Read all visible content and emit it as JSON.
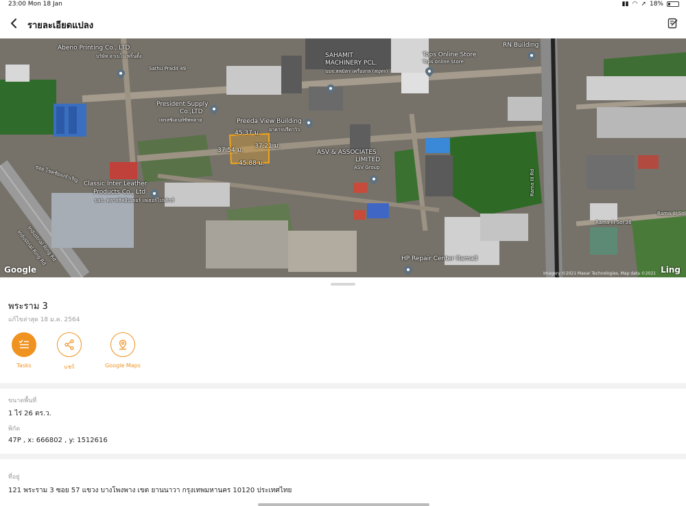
{
  "status_bar": {
    "time_date": "23:00  Mon 18 Jan",
    "battery": "18%"
  },
  "header": {
    "title": "รายละเอียดแปลง"
  },
  "map": {
    "labels": {
      "abeno": "Abeno Printing Co., LTD",
      "abeno_th": "บริษัท อาเบโน่ พริ้นติ้ง",
      "sathu_pradit": "Sathu Pradit 49",
      "sahamit": "SAHAMIT",
      "sahamit2": "MACHINERY PCL.",
      "sahamit_th": "บมจ.สหมิตร เครื่องกล (สมุทร)",
      "tops": "Tops Online Store",
      "tops_th": "Tops online Store",
      "rn": "RN Building",
      "president": "President Supply",
      "president2": "Co.,LTD",
      "president_th": "เพรสซิเดนท์ซัพพลาย",
      "preeda": "Preeda View Building",
      "preeda_th": "อาคารปรีดาวิว",
      "asv": "ASV & ASSOCIATES",
      "asv2": "LIMITED",
      "asv_th": "ASV Group",
      "classic": "Classic Inter Leather",
      "classic2": "Products Co., Ltd",
      "classic_th": "บจก. คลาสสิคอินเตอร์ เลเธอร์โปรดักส์",
      "soi": "ซอย โชคชัยจงจำเริญ",
      "rama3_rd": "Rama III Rd",
      "rama3_soi36": "Rama III Soi 36",
      "rama3_soi": "Rama III Soi",
      "ring_rd1": "Industrial Ring Rd",
      "ring_rd2": "Industrial Ring Rd",
      "hp": "HP Repair Center Rama3",
      "credit": "Imagery ©2021 Maxar Technologies, Map data ©2021"
    },
    "plot_dimensions": {
      "top": "45.37 ม.",
      "left": "37.54 ม.",
      "right": "37.21 ม.",
      "bottom": "45.88 ม."
    },
    "google_logo": "Google",
    "ling_logo": "Ling"
  },
  "place": {
    "name": "พระราม 3",
    "updated": "แก้ไขล่าสุด 18 ม.ค. 2564"
  },
  "actions": [
    {
      "label": "Tasks",
      "icon": "tasks-icon"
    },
    {
      "label": "แชร์",
      "icon": "share-icon"
    },
    {
      "label": "Google Maps",
      "icon": "google-maps-icon"
    }
  ],
  "details": {
    "area_label": "ขนาดพื้นที่",
    "area_value": "1 ไร่  26 ตร.ว.",
    "coord_label": "พิกัด",
    "coord_value": "47P ,  x: 666802 ,  y: 1512616",
    "address_label": "ที่อยู่",
    "address_value": "121 พระราม 3 ซอย 57 แขวง บางโพงพาง เขต ยานนาวา กรุงเทพมหานคร 10120 ประเทศไทย"
  },
  "colors": {
    "accent": "#f0921f",
    "plot_outline": "#f2a31a"
  }
}
